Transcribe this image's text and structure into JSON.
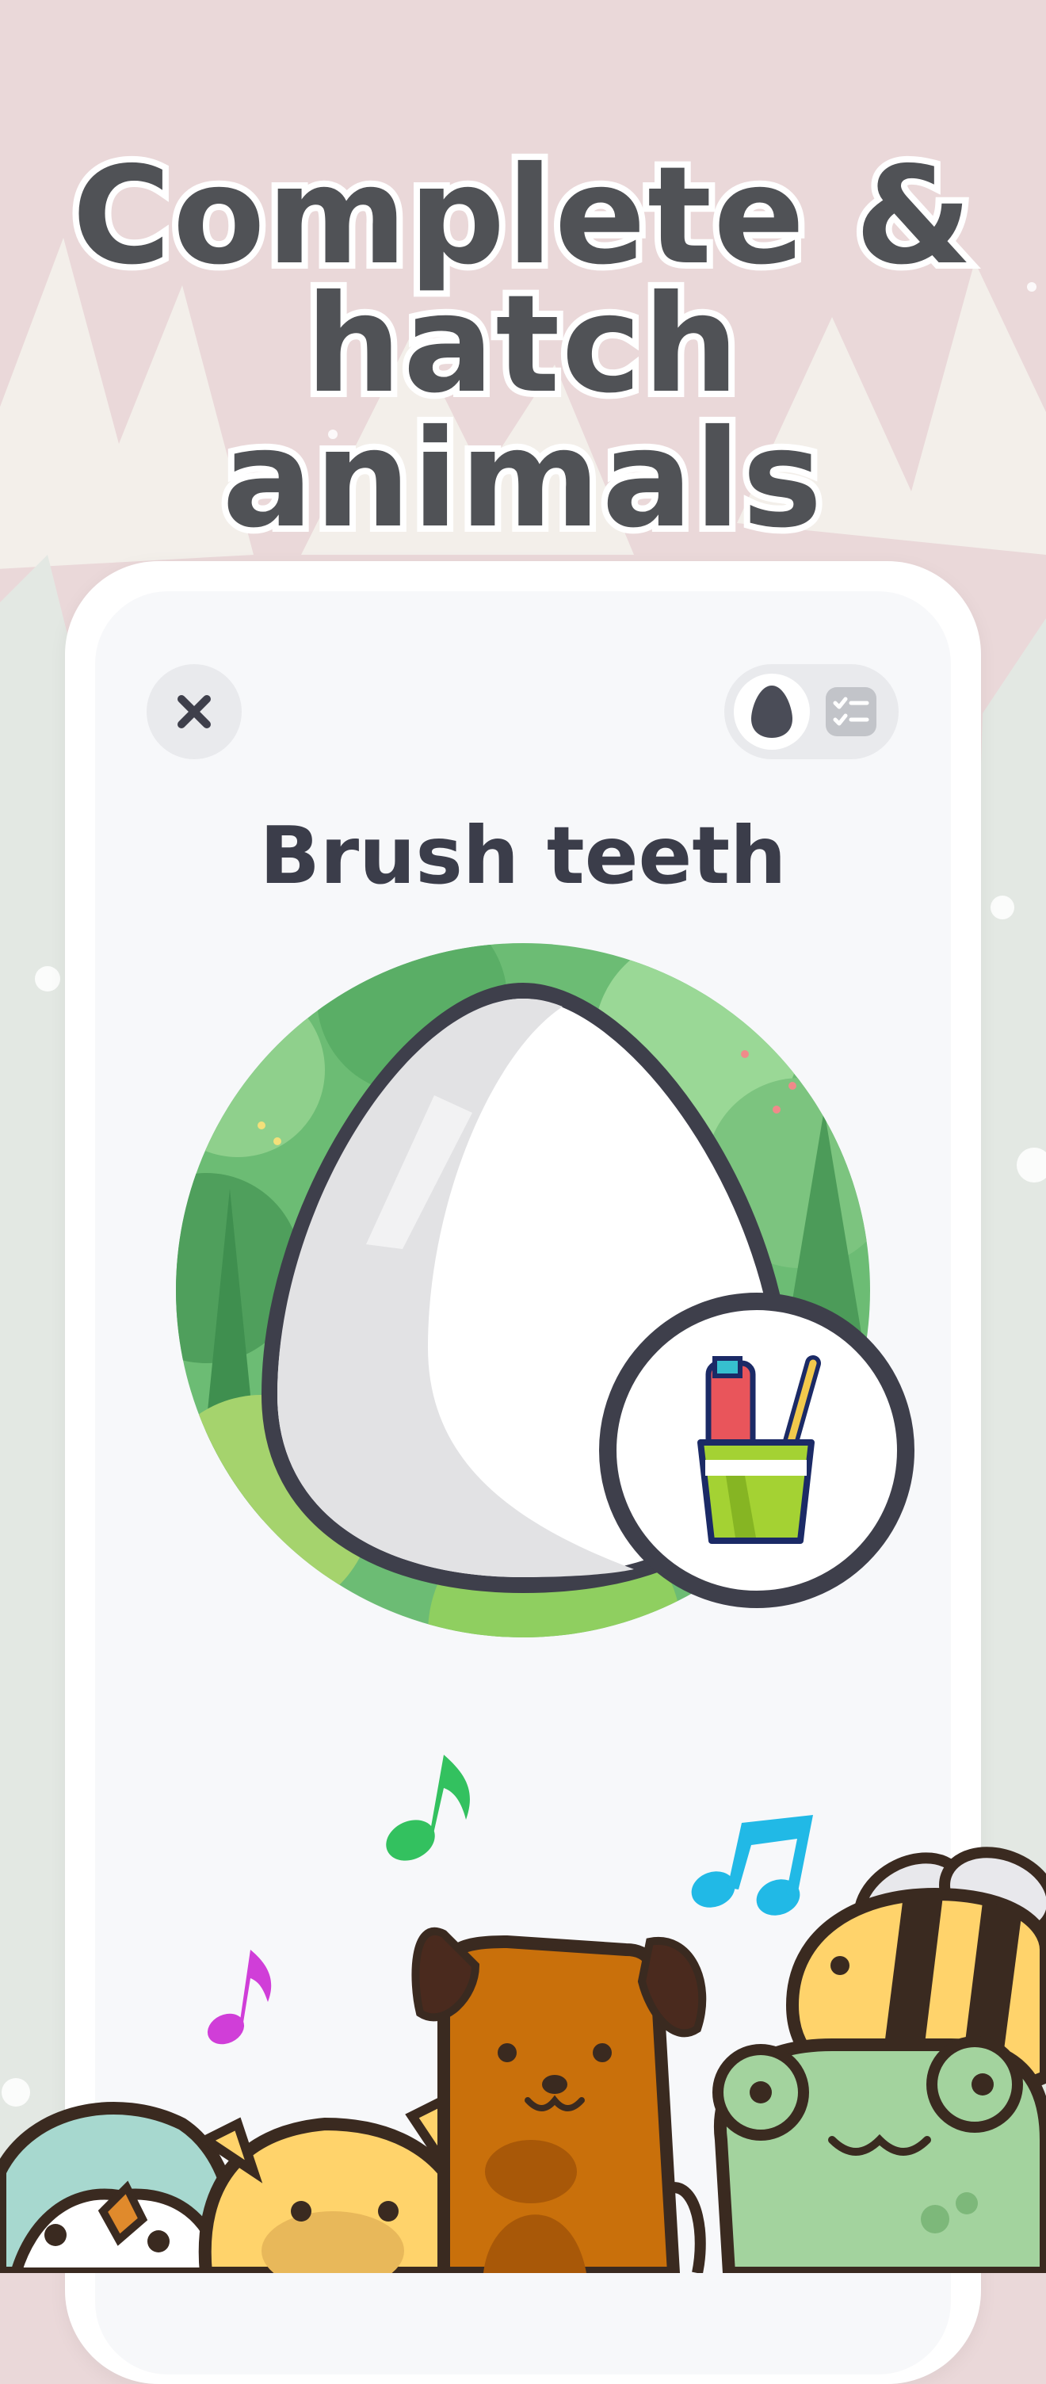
{
  "headline": {
    "line1": "Complete &",
    "line2": "hatch animals"
  },
  "task": {
    "title": "Brush teeth"
  },
  "toolbar": {
    "close_icon": "close-icon",
    "toggle_left_icon": "egg-icon",
    "toggle_right_icon": "checklist-icon"
  },
  "colors": {
    "background": "#ead8d9",
    "headline_text": "#505256",
    "title_text": "#3b3d4a",
    "egg_outline": "#3e3f4b",
    "forest": "#6cbc74",
    "note_green": "#33c15f",
    "note_blue": "#21b9e6",
    "note_magenta": "#d03ed8"
  }
}
